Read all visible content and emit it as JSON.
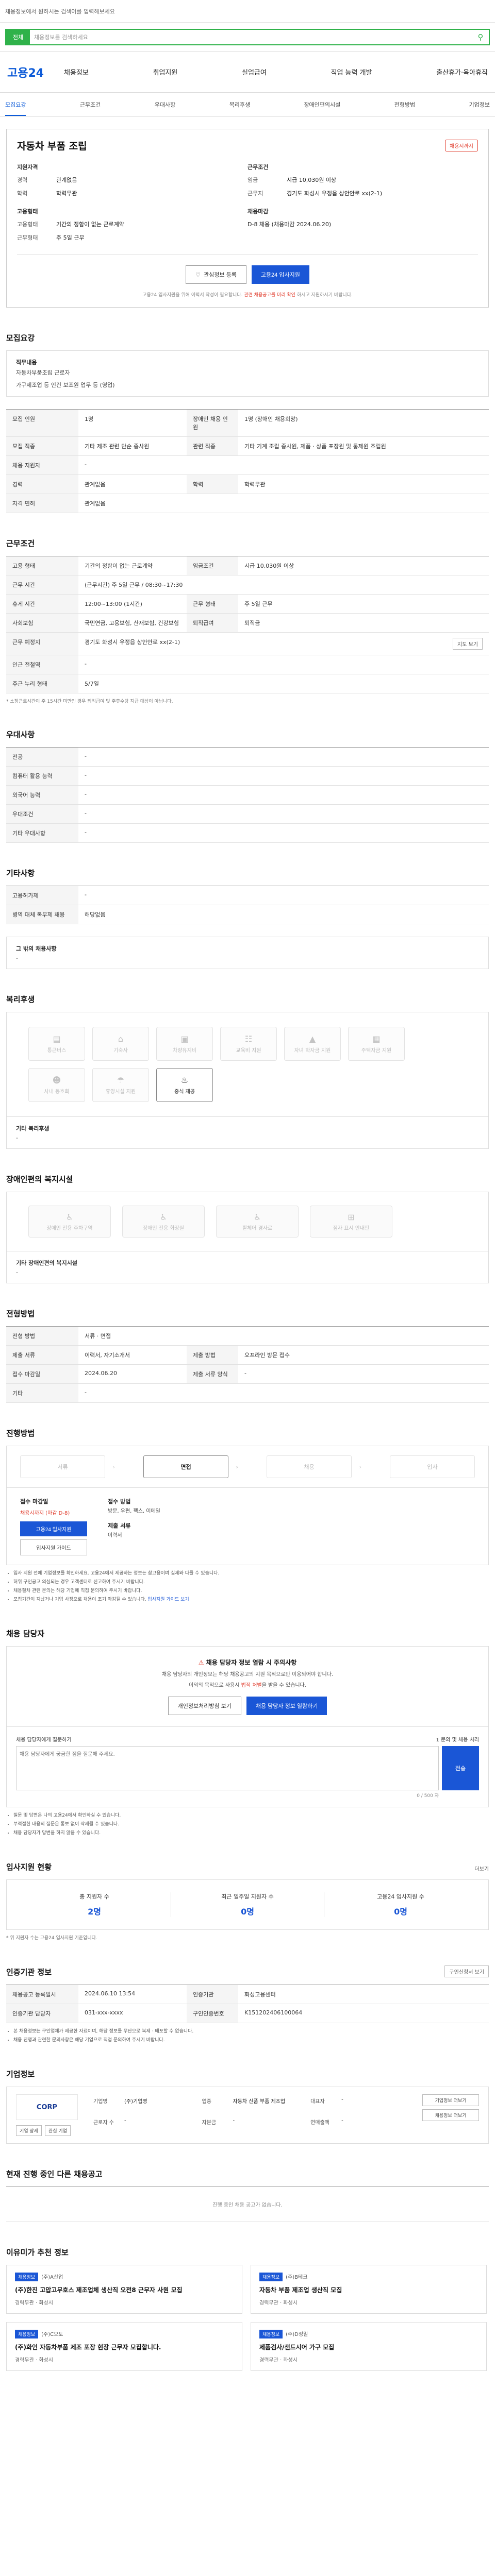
{
  "top": {
    "hint": "채용정보에서 원하시는 검색어를 입력해보세요"
  },
  "search": {
    "category": "전체",
    "placeholder": "채용정보를 검색하세요"
  },
  "gnb": {
    "logo": "고용24",
    "menu": [
      "채용정보",
      "취업지원",
      "실업급여",
      "직업 능력 개발",
      "출산휴가·육아휴직"
    ]
  },
  "subnav": [
    "모집요강",
    "근무조건",
    "우대사항",
    "복리후생",
    "장애인편의시설",
    "전형방법",
    "기업정보"
  ],
  "summary": {
    "title": "자동차 부품 조립",
    "badge": "채용시까지",
    "left_heading": "지원자격",
    "exp_k": "경력",
    "exp_v": "관계없음",
    "edu_k": "학력",
    "edu_v": "학력무관",
    "type_heading": "고용형태",
    "emp_k": "고용형태",
    "emp_v": "기간의 정함이 없는 근로계약",
    "hours_k": "근무형태",
    "hours_v": "주 5일 근무",
    "right_heading": "근무조건",
    "pay_k": "임금",
    "pay_v": "시급 10,030원 이상",
    "place_k": "근무지",
    "place_v": "경기도 화성시 우정읍 상안안로 xx(2-1)",
    "deadline_heading": "채용마감",
    "deadline_v": "D-8 채용 (채용마감 2024.06.20)",
    "interest_btn": "관심정보 등록",
    "apply_btn": "고용24 입사지원",
    "notice": "고용24 입사지원을 위해 이력서 작성이 필요합니다.",
    "notice_red": "관련 채용공고를 미리 확인",
    "notice_tail": "하시고 지원하시기 바랍니다."
  },
  "recruit": {
    "title": "모집요강",
    "duty_l": "직무내용",
    "duty_v": "자동차부품조립 근로자",
    "benefit_l": "가구제조업 등 인건 보조원 업무 등 (영업)",
    "rows": [
      {
        "k": "모집 인원",
        "v": "1명",
        "k2": "장애인 채용 인원",
        "v2": "1명 (장애인 채용희망)"
      },
      {
        "k": "모집 직종",
        "v": "기타 제조 관련 단순 종사원",
        "k2": "관련 직종",
        "v2": "기타 기계 조립 종사원, 제품 · 상품 포장원 및 통제원 조립원"
      },
      {
        "k": "채용 지원자",
        "v": "-",
        "k2": "",
        "v2": ""
      },
      {
        "k": "경력",
        "v": "관계없음",
        "k2": "학력",
        "v2": "학력무관"
      },
      {
        "k": "자격 면허",
        "v": "관계없음",
        "k2": "",
        "v2": ""
      }
    ]
  },
  "conditions": {
    "title": "근무조건",
    "rows": [
      {
        "k": "고용 형태",
        "v": "기간의 정함이 없는 근로계약",
        "k2": "임금조건",
        "v2": "시급 10,030원 이상"
      },
      {
        "k": "근무 시간",
        "v": "(근무시간) 주 5일 근무 / 08:30~17:30",
        "k2": "",
        "v2": ""
      },
      {
        "k": "휴게 시간",
        "v": "12:00~13:00 (1시간)",
        "k2": "근무 형태",
        "v2": "주 5일 근무"
      },
      {
        "k": "사회보험",
        "v": "국민연금, 고용보험, 산재보험, 건강보험",
        "k2": "퇴직급여",
        "v2": "퇴직금"
      },
      {
        "k": "근무 예정지",
        "v": "경기도 화성시 우정읍 상안안로 xx(2-1)",
        "k2": "",
        "v2": ""
      },
      {
        "k": "인근 전철역",
        "v": "-",
        "k2": "",
        "v2": ""
      },
      {
        "k": "주근 누리 형태",
        "v": "5/7일",
        "k2": "",
        "v2": ""
      }
    ],
    "map_btn": "지도 보기",
    "note": "* 소정근로시간이 주 15시간 미만인 경우 퇴직급여 및 주휴수당 지급 대상이 아닙니다."
  },
  "preference": {
    "title": "우대사항",
    "rows": [
      {
        "k": "전공",
        "v": "-"
      },
      {
        "k": "컴퓨터 활용 능력",
        "v": "-"
      },
      {
        "k": "외국어 능력",
        "v": "-"
      },
      {
        "k": "우대조건",
        "v": "-"
      },
      {
        "k": "기타 우대사항",
        "v": "-"
      }
    ]
  },
  "etc": {
    "title": "기타사항",
    "rows": [
      {
        "k": "고용허가제",
        "v": "-"
      },
      {
        "k": "병역 대체 복무제 채용",
        "v": "해당없음"
      }
    ],
    "other_l": "그 밖의 채용사항",
    "other_v": "-"
  },
  "welfare": {
    "title": "복리후생",
    "items": [
      {
        "label": "통근버스",
        "icon": "bus-icon",
        "on": false
      },
      {
        "label": "기숙사",
        "icon": "house-icon",
        "on": false
      },
      {
        "label": "차량유지비",
        "icon": "car-icon",
        "on": false
      },
      {
        "label": "교육비 지원",
        "icon": "book-icon",
        "on": false
      },
      {
        "label": "자녀 학자금 지원",
        "icon": "cap-icon",
        "on": false
      },
      {
        "label": "주택자금 지원",
        "icon": "building-icon",
        "on": false
      },
      {
        "label": "사내 동호회",
        "icon": "group-icon",
        "on": false
      },
      {
        "label": "휴양시설 지원",
        "icon": "umbrella-icon",
        "on": false
      },
      {
        "label": "중식 제공",
        "icon": "meal-icon",
        "on": true
      }
    ],
    "etc_l": "기타 복리후생",
    "etc_v": "-"
  },
  "disability": {
    "title": "장애인편의 복지시설",
    "items": [
      "장애인 전용 주차구역",
      "장애인 전용 화장실",
      "휠체어 경사로",
      "점자 표시 안내판"
    ],
    "etc_l": "기타 장애인편의 복지시설",
    "etc_v": "-"
  },
  "method": {
    "title": "전형방법",
    "rows": [
      {
        "k": "전형 방법",
        "v": "서류 · 면접",
        "k2": "",
        "v2": ""
      },
      {
        "k": "제출 서류",
        "v": "이력서, 자기소개서",
        "k2": "제출 방법",
        "v2": "오프라인 방문 접수"
      },
      {
        "k": "접수 마감일",
        "v": "2024.06.20",
        "k2": "제출 서류 양식",
        "v2": "-"
      },
      {
        "k": "기타",
        "v": "-",
        "k2": "",
        "v2": ""
      }
    ]
  },
  "process": {
    "title": "진행방법",
    "steps": [
      "서류",
      "면접",
      "채용",
      "입사"
    ],
    "active": 1,
    "col1_h": "접수 마감일",
    "col1_red": "채용시까지 (마감 D-8)",
    "col1_btn": "고용24 입사지원",
    "col1_btn2": "입사지원 가이드",
    "col2_h": "접수 방법",
    "col2_t": "방문, 우편, 팩스, 이메일",
    "col3_h": "제출 서류",
    "col3_t": "이력서",
    "bullets": [
      "입사 지원 전에 기업정보를 확인하세요. 고용24에서 제공하는 정보는 참고용이며 실제와 다를 수 있습니다.",
      "허위 구인공고 의심되는 경우 고객센터로 신고하여 주시기 바랍니다.",
      "채용절차 관련 문의는 해당 기업에 직접 문의하여 주시기 바랍니다.",
      "모집기간이 지났거나 기업 사정으로 채용이 조기 마감될 수 있습니다."
    ],
    "guide_link": "입사지원 가이드 보기"
  },
  "contact": {
    "title": "채용 담당자",
    "alert": "채용 담당자 정보 열람 시 주의사항",
    "alert_s1": "채용 담당자의 개인정보는 해당 채용공고의 지원 목적으로만 이용되어야 합니다.",
    "alert_s2": "이외의 목적으로 사용시",
    "alert_s2_red": "법적 처벌",
    "alert_s2_tail": "을 받을 수 있습니다.",
    "btn1": "개인정보처리방침 보기",
    "btn2": "채용 담당자 정보 열람하기",
    "qa_h": "채용 담당자에게 질문하기",
    "qa_h2": "1 문의 및 채용 처리",
    "qa_placeholder": "채용 담당자에게 궁금한 점을 질문해 주세요.",
    "send": "전송",
    "count": "0 / 500 자",
    "bullets": [
      "질문 및 답변은 나의 고용24에서 확인하실 수 있습니다.",
      "부적절한 내용의 질문은 통보 없이 삭제될 수 있습니다.",
      "채용 담당자가 답변을 하지 않을 수 있습니다."
    ]
  },
  "stats": {
    "title": "입사지원 현황",
    "more": "더보기",
    "items": [
      {
        "n": "총 지원자 수",
        "v": "2명"
      },
      {
        "n": "최근 일주일 지원자 수",
        "v": "0명"
      },
      {
        "n": "고용24 입사지원 수",
        "v": "0명"
      }
    ],
    "note": "* 위 지원자 수는 고용24 입사지원 기준입니다."
  },
  "info": {
    "title": "인증기관 정보",
    "btn": "구인신청서 보기",
    "rows": [
      {
        "k": "채용공고 등록일시",
        "v": "2024.06.10 13:54",
        "k2": "인증기관",
        "v2": "화성고용센터"
      },
      {
        "k": "인증기관 담당자",
        "v": "031-xxx-xxxx",
        "k2": "구인인증번호",
        "v2": "K151202406100064"
      }
    ],
    "notes": [
      "본 채용정보는 구인업체가 제공한 자료이며, 해당 정보를 무단으로 복제 · 배포할 수 없습니다.",
      "채용 진행과 관련한 문의사항은 해당 기업으로 직접 문의하여 주시기 바랍니다."
    ]
  },
  "company": {
    "title": "기업정보",
    "logo": "CORP",
    "b1": "기업 상세",
    "b2": "관심 기업",
    "fields": [
      {
        "k": "기업명",
        "v": "(주)기업명"
      },
      {
        "k": "업종",
        "v": "자동차 신품 부품 제조업"
      },
      {
        "k": "대표자",
        "v": "-"
      },
      {
        "k": "근로자 수",
        "v": "-"
      },
      {
        "k": "자본금",
        "v": "-"
      },
      {
        "k": "연매출액",
        "v": "-"
      }
    ],
    "side1": "기업정보 더보기",
    "side2": "채용정보 더보기"
  },
  "similar": {
    "title": "현재 진행 중인 다른 채용공고",
    "empty": "진행 중인 채용 공고가 없습니다."
  },
  "reco": {
    "title": "이유미가 추천 정보",
    "cards": [
      {
        "badge": "채용정보",
        "co": "(주)A산업",
        "t": "(주)한진 고압고무호스 제조업체 생산직 오전8 근무자 사원 모집",
        "meta": "경력무관 · 화성시"
      },
      {
        "badge": "채용정보",
        "co": "(주)B테크",
        "t": "자동차 부품 제조업 생산직 모집",
        "meta": "경력무관 · 화성시"
      },
      {
        "badge": "채용정보",
        "co": "(주)C오토",
        "t": "(주)화인 자동차부품 제조 포장 현장 근무자 모집합니다.",
        "meta": "경력무관 · 화성시"
      },
      {
        "badge": "채용정보",
        "co": "(주)D정밀",
        "t": "제품검사/샌드시어 가구 모집",
        "meta": "경력무관 · 화성시"
      }
    ]
  }
}
